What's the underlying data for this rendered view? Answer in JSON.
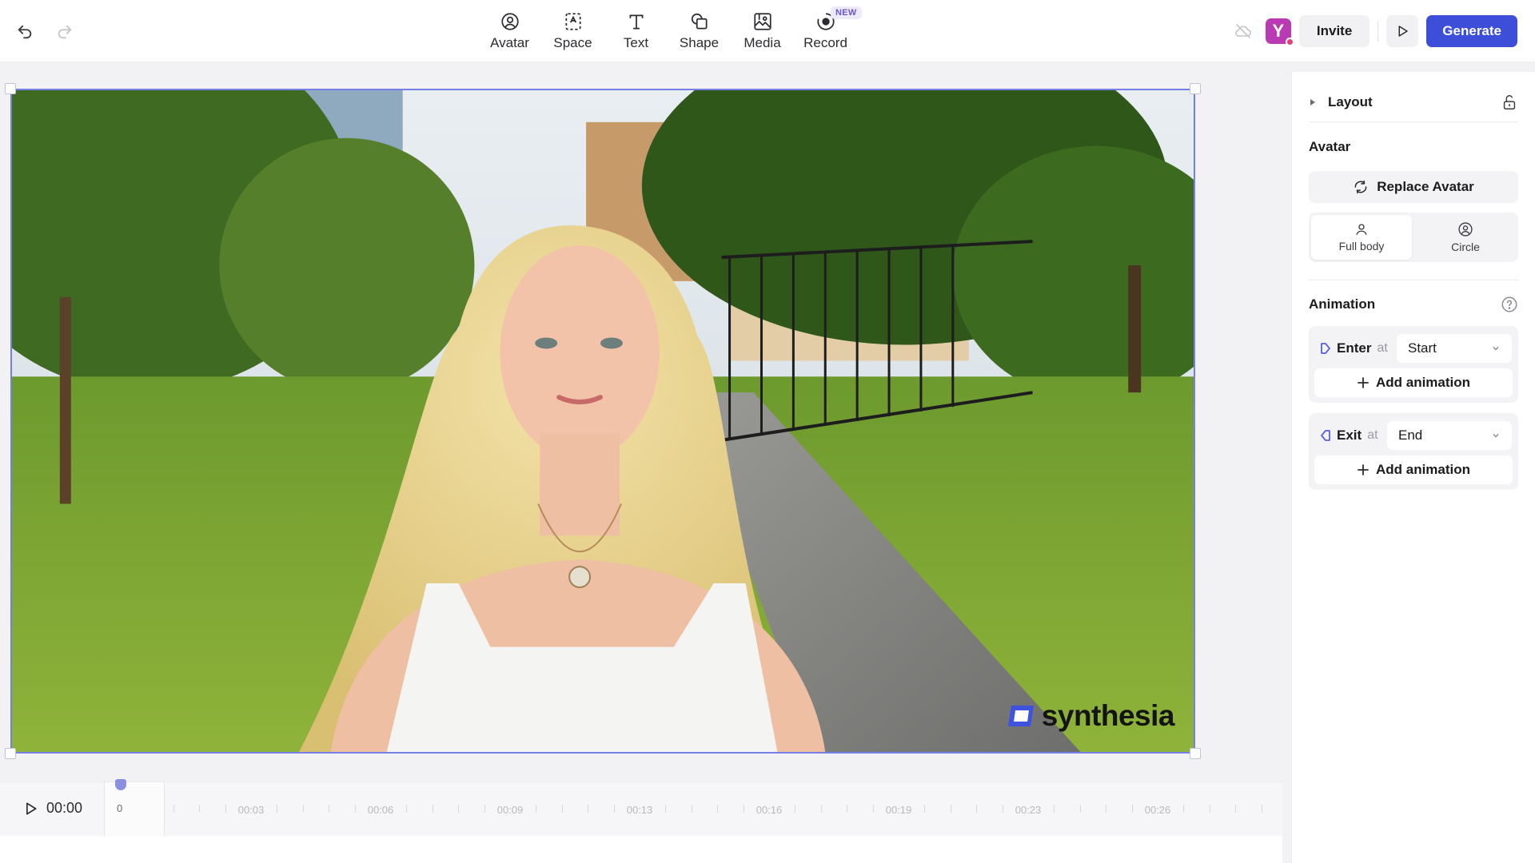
{
  "toolbar": {
    "tools": [
      {
        "label": "Avatar",
        "icon": "avatar-icon"
      },
      {
        "label": "Space",
        "icon": "space-icon"
      },
      {
        "label": "Text",
        "icon": "text-icon"
      },
      {
        "label": "Shape",
        "icon": "shape-icon"
      },
      {
        "label": "Media",
        "icon": "media-icon"
      },
      {
        "label": "Record",
        "icon": "record-icon"
      }
    ],
    "new_badge": "NEW",
    "user_initial": "Y",
    "invite_label": "Invite",
    "generate_label": "Generate"
  },
  "canvas": {
    "watermark": "synthesia"
  },
  "timeline": {
    "current_time": "00:00",
    "scene_start": "0",
    "ticks": [
      "00:03",
      "00:06",
      "00:09",
      "00:13",
      "00:16",
      "00:19",
      "00:23",
      "00:26"
    ]
  },
  "panel": {
    "layout_title": "Layout",
    "avatar_title": "Avatar",
    "replace_avatar_label": "Replace Avatar",
    "avatar_styles": [
      {
        "label": "Full body",
        "active": true
      },
      {
        "label": "Circle",
        "active": false
      }
    ],
    "animation_title": "Animation",
    "enter": {
      "label": "Enter",
      "at": "at",
      "value": "Start",
      "add_label": "Add animation"
    },
    "exit": {
      "label": "Exit",
      "at": "at",
      "value": "End",
      "add_label": "Add animation"
    }
  },
  "colors": {
    "accent": "#3d4fd8",
    "selection": "#7480e8",
    "user_badge": "#b93ab3"
  }
}
